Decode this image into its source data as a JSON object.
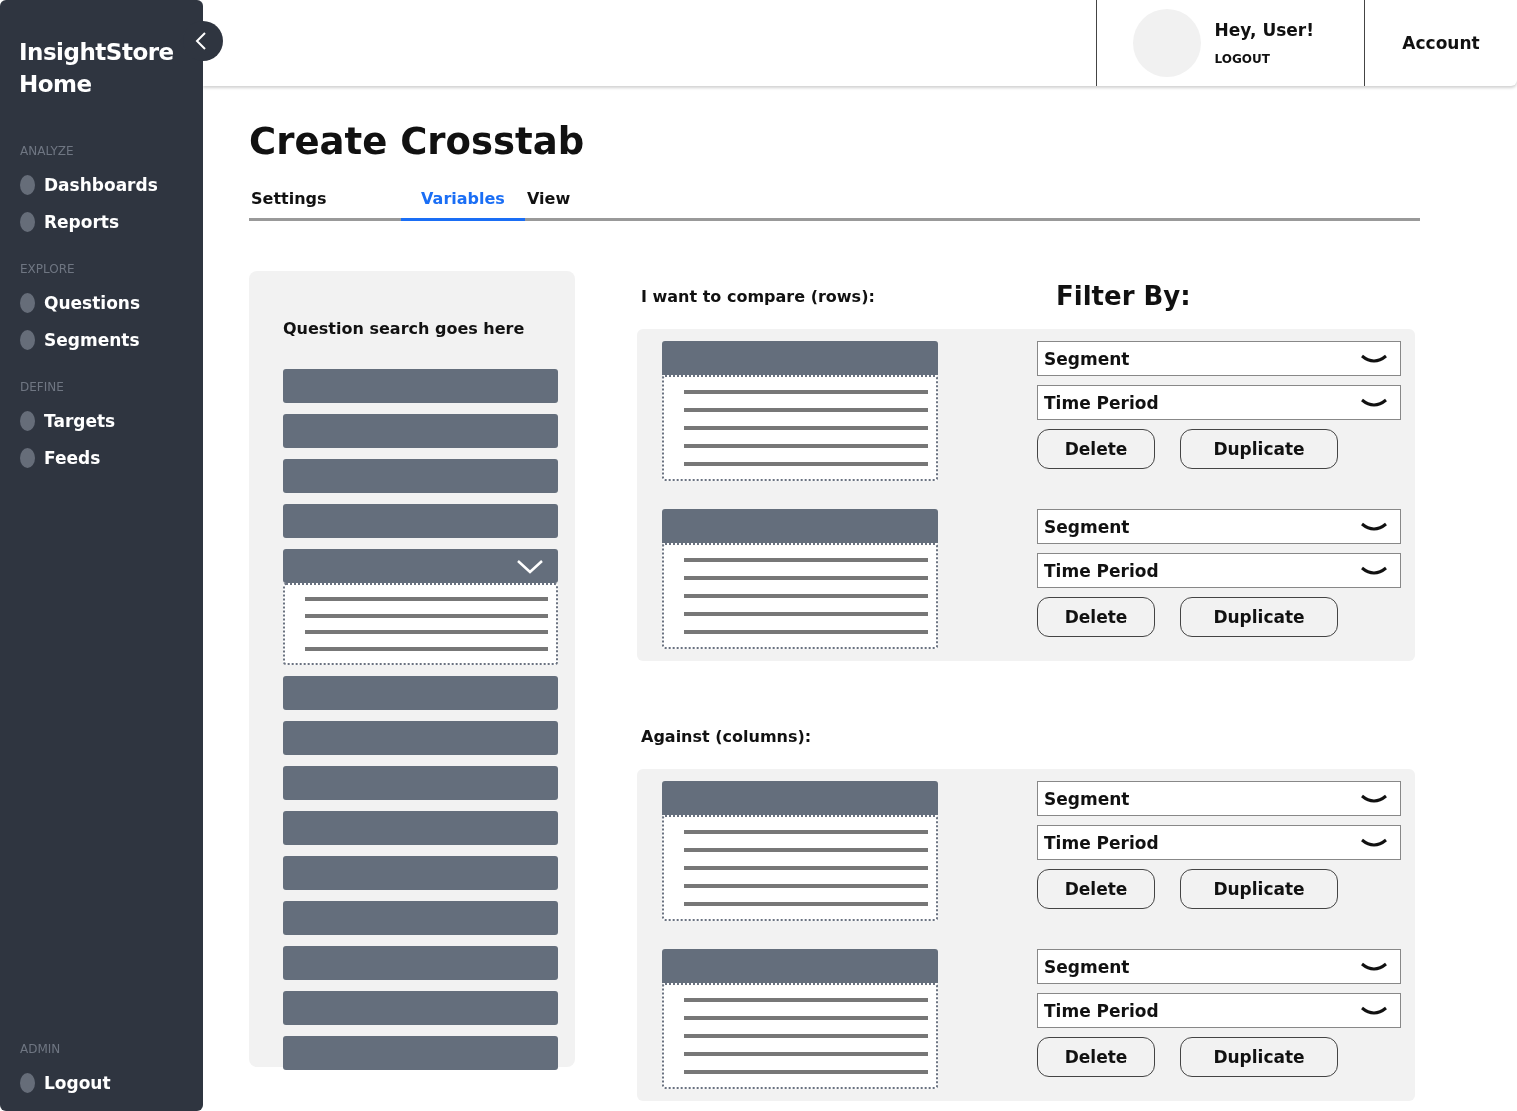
{
  "sidebar": {
    "title": "InsightStore Home",
    "sections": [
      {
        "heading": "ANALYZE",
        "items": [
          {
            "label": "Dashboards"
          },
          {
            "label": "Reports"
          }
        ]
      },
      {
        "heading": "EXPLORE",
        "items": [
          {
            "label": "Questions"
          },
          {
            "label": "Segments"
          }
        ]
      },
      {
        "heading": "DEFINE",
        "items": [
          {
            "label": "Targets"
          },
          {
            "label": "Feeds"
          }
        ]
      },
      {
        "heading": "ADMIN",
        "items": [
          {
            "label": "Logout"
          }
        ]
      }
    ]
  },
  "header": {
    "greeting": "Hey, User!",
    "logout": "LOGOUT",
    "account": "Account"
  },
  "page_title": "Create Crosstab",
  "tabs": [
    {
      "label": "Settings",
      "selected": false
    },
    {
      "label": "Variables",
      "selected": true
    },
    {
      "label": "View",
      "selected": false
    }
  ],
  "question_panel": {
    "search": "Question search goes here",
    "items": [
      {
        "expanded": false
      },
      {
        "expanded": false
      },
      {
        "expanded": false
      },
      {
        "expanded": false
      },
      {
        "expanded": true
      },
      {
        "expanded": false
      },
      {
        "expanded": false
      },
      {
        "expanded": false
      },
      {
        "expanded": false
      },
      {
        "expanded": false
      },
      {
        "expanded": false
      },
      {
        "expanded": false
      },
      {
        "expanded": false
      },
      {
        "expanded": false
      }
    ]
  },
  "filter_heading": "Filter By:",
  "groups": [
    {
      "heading": "I want to compare (rows):",
      "variables": [
        {
          "filters": [
            "Segment",
            "Time Period"
          ],
          "buttons": [
            "Delete",
            "Duplicate"
          ]
        },
        {
          "filters": [
            "Segment",
            "Time Period"
          ],
          "buttons": [
            "Delete",
            "Duplicate"
          ]
        }
      ]
    },
    {
      "heading": "Against (columns):",
      "variables": [
        {
          "filters": [
            "Segment",
            "Time Period"
          ],
          "buttons": [
            "Delete",
            "Duplicate"
          ]
        },
        {
          "filters": [
            "Segment",
            "Time Period"
          ],
          "buttons": [
            "Delete",
            "Duplicate"
          ]
        }
      ]
    }
  ]
}
